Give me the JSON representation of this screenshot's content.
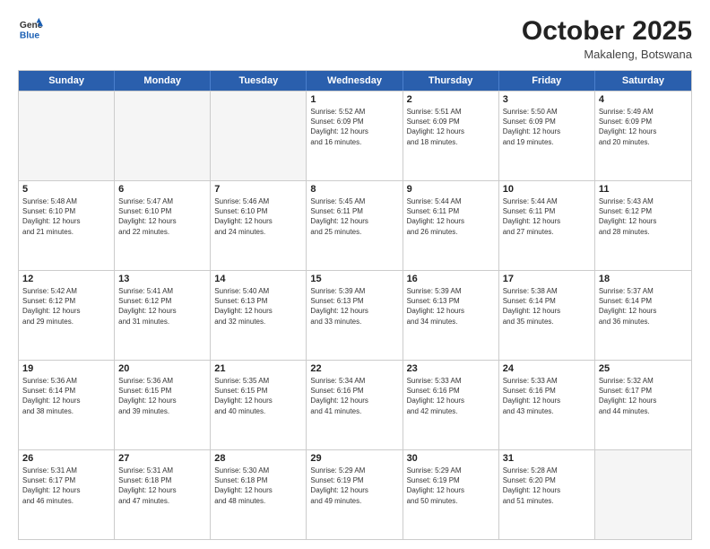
{
  "header": {
    "logo_line1": "General",
    "logo_line2": "Blue",
    "month": "October 2025",
    "location": "Makaleng, Botswana"
  },
  "weekdays": [
    "Sunday",
    "Monday",
    "Tuesday",
    "Wednesday",
    "Thursday",
    "Friday",
    "Saturday"
  ],
  "rows": [
    [
      {
        "day": "",
        "info": ""
      },
      {
        "day": "",
        "info": ""
      },
      {
        "day": "",
        "info": ""
      },
      {
        "day": "1",
        "info": "Sunrise: 5:52 AM\nSunset: 6:09 PM\nDaylight: 12 hours\nand 16 minutes."
      },
      {
        "day": "2",
        "info": "Sunrise: 5:51 AM\nSunset: 6:09 PM\nDaylight: 12 hours\nand 18 minutes."
      },
      {
        "day": "3",
        "info": "Sunrise: 5:50 AM\nSunset: 6:09 PM\nDaylight: 12 hours\nand 19 minutes."
      },
      {
        "day": "4",
        "info": "Sunrise: 5:49 AM\nSunset: 6:09 PM\nDaylight: 12 hours\nand 20 minutes."
      }
    ],
    [
      {
        "day": "5",
        "info": "Sunrise: 5:48 AM\nSunset: 6:10 PM\nDaylight: 12 hours\nand 21 minutes."
      },
      {
        "day": "6",
        "info": "Sunrise: 5:47 AM\nSunset: 6:10 PM\nDaylight: 12 hours\nand 22 minutes."
      },
      {
        "day": "7",
        "info": "Sunrise: 5:46 AM\nSunset: 6:10 PM\nDaylight: 12 hours\nand 24 minutes."
      },
      {
        "day": "8",
        "info": "Sunrise: 5:45 AM\nSunset: 6:11 PM\nDaylight: 12 hours\nand 25 minutes."
      },
      {
        "day": "9",
        "info": "Sunrise: 5:44 AM\nSunset: 6:11 PM\nDaylight: 12 hours\nand 26 minutes."
      },
      {
        "day": "10",
        "info": "Sunrise: 5:44 AM\nSunset: 6:11 PM\nDaylight: 12 hours\nand 27 minutes."
      },
      {
        "day": "11",
        "info": "Sunrise: 5:43 AM\nSunset: 6:12 PM\nDaylight: 12 hours\nand 28 minutes."
      }
    ],
    [
      {
        "day": "12",
        "info": "Sunrise: 5:42 AM\nSunset: 6:12 PM\nDaylight: 12 hours\nand 29 minutes."
      },
      {
        "day": "13",
        "info": "Sunrise: 5:41 AM\nSunset: 6:12 PM\nDaylight: 12 hours\nand 31 minutes."
      },
      {
        "day": "14",
        "info": "Sunrise: 5:40 AM\nSunset: 6:13 PM\nDaylight: 12 hours\nand 32 minutes."
      },
      {
        "day": "15",
        "info": "Sunrise: 5:39 AM\nSunset: 6:13 PM\nDaylight: 12 hours\nand 33 minutes."
      },
      {
        "day": "16",
        "info": "Sunrise: 5:39 AM\nSunset: 6:13 PM\nDaylight: 12 hours\nand 34 minutes."
      },
      {
        "day": "17",
        "info": "Sunrise: 5:38 AM\nSunset: 6:14 PM\nDaylight: 12 hours\nand 35 minutes."
      },
      {
        "day": "18",
        "info": "Sunrise: 5:37 AM\nSunset: 6:14 PM\nDaylight: 12 hours\nand 36 minutes."
      }
    ],
    [
      {
        "day": "19",
        "info": "Sunrise: 5:36 AM\nSunset: 6:14 PM\nDaylight: 12 hours\nand 38 minutes."
      },
      {
        "day": "20",
        "info": "Sunrise: 5:36 AM\nSunset: 6:15 PM\nDaylight: 12 hours\nand 39 minutes."
      },
      {
        "day": "21",
        "info": "Sunrise: 5:35 AM\nSunset: 6:15 PM\nDaylight: 12 hours\nand 40 minutes."
      },
      {
        "day": "22",
        "info": "Sunrise: 5:34 AM\nSunset: 6:16 PM\nDaylight: 12 hours\nand 41 minutes."
      },
      {
        "day": "23",
        "info": "Sunrise: 5:33 AM\nSunset: 6:16 PM\nDaylight: 12 hours\nand 42 minutes."
      },
      {
        "day": "24",
        "info": "Sunrise: 5:33 AM\nSunset: 6:16 PM\nDaylight: 12 hours\nand 43 minutes."
      },
      {
        "day": "25",
        "info": "Sunrise: 5:32 AM\nSunset: 6:17 PM\nDaylight: 12 hours\nand 44 minutes."
      }
    ],
    [
      {
        "day": "26",
        "info": "Sunrise: 5:31 AM\nSunset: 6:17 PM\nDaylight: 12 hours\nand 46 minutes."
      },
      {
        "day": "27",
        "info": "Sunrise: 5:31 AM\nSunset: 6:18 PM\nDaylight: 12 hours\nand 47 minutes."
      },
      {
        "day": "28",
        "info": "Sunrise: 5:30 AM\nSunset: 6:18 PM\nDaylight: 12 hours\nand 48 minutes."
      },
      {
        "day": "29",
        "info": "Sunrise: 5:29 AM\nSunset: 6:19 PM\nDaylight: 12 hours\nand 49 minutes."
      },
      {
        "day": "30",
        "info": "Sunrise: 5:29 AM\nSunset: 6:19 PM\nDaylight: 12 hours\nand 50 minutes."
      },
      {
        "day": "31",
        "info": "Sunrise: 5:28 AM\nSunset: 6:20 PM\nDaylight: 12 hours\nand 51 minutes."
      },
      {
        "day": "",
        "info": ""
      }
    ]
  ]
}
